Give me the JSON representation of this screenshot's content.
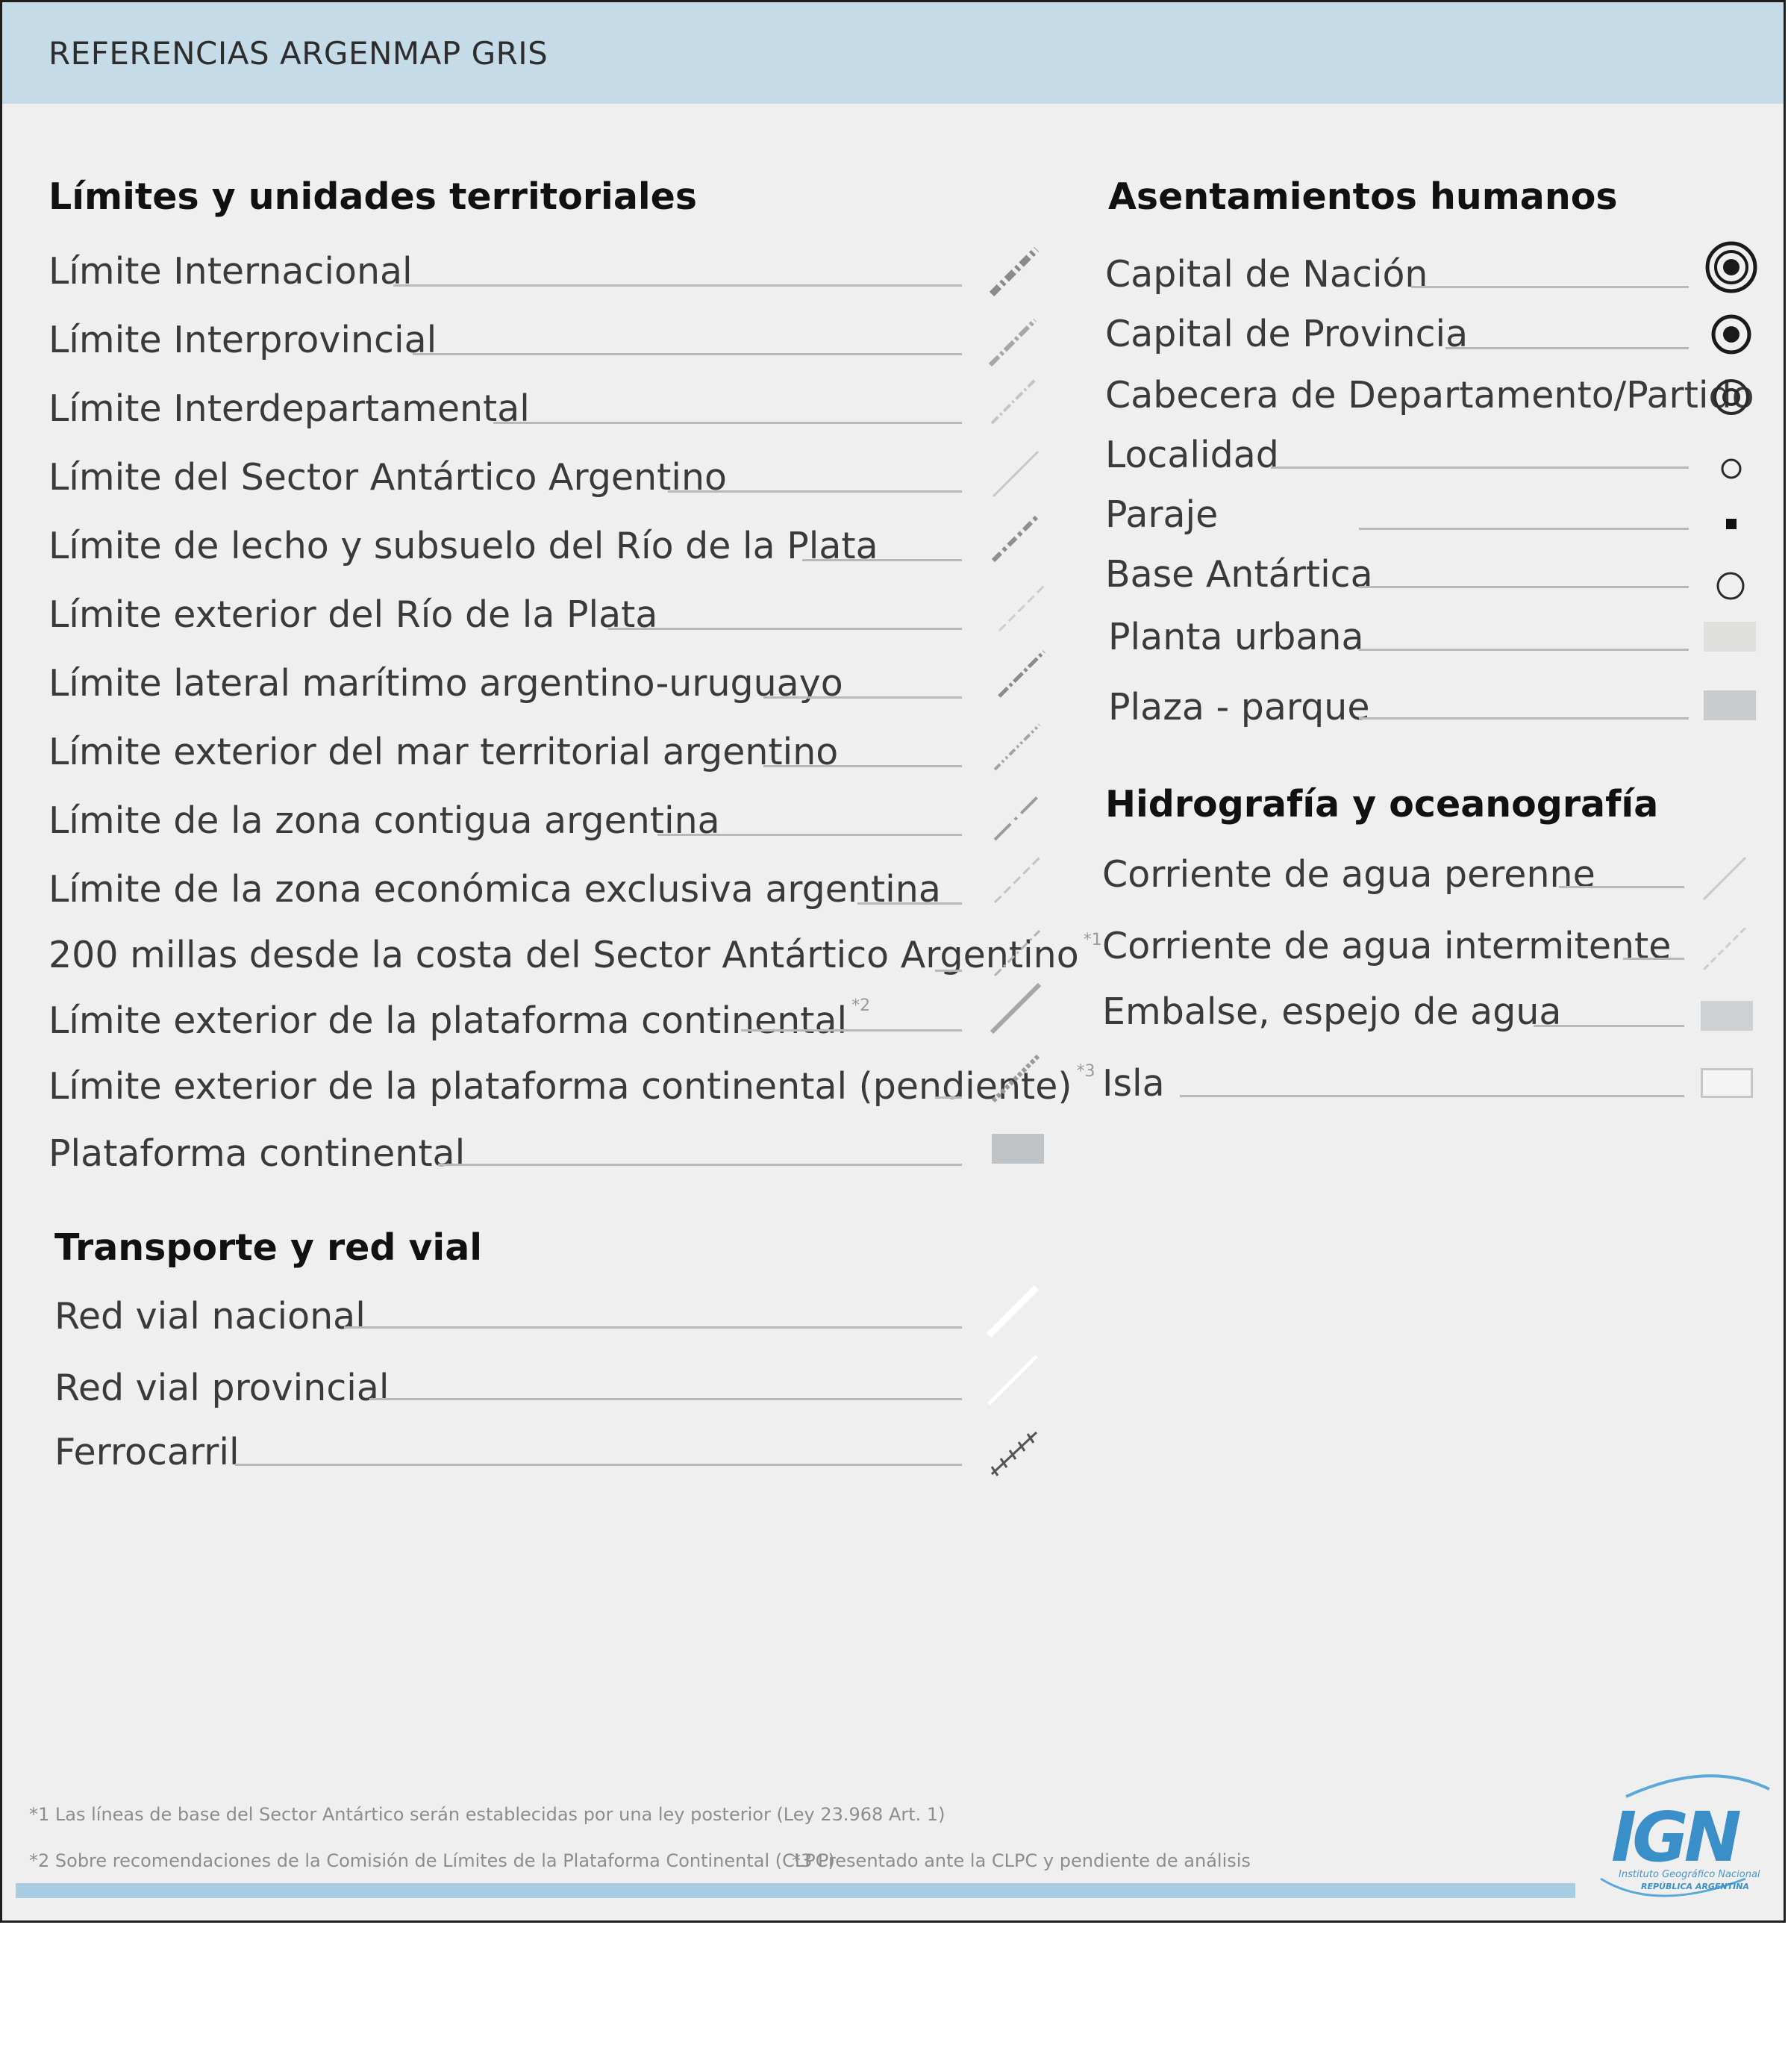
{
  "title": "REFERENCIAS ARGENMAP GRIS",
  "sections": {
    "limites": {
      "title": "Límites y unidades territoriales",
      "items": [
        {
          "label": "Límite Internacional"
        },
        {
          "label": "Límite Interprovincial"
        },
        {
          "label": "Límite Interdepartamental"
        },
        {
          "label": "Límite del Sector Antártico Argentino"
        },
        {
          "label": "Límite de lecho y subsuelo del Río de la Plata"
        },
        {
          "label": "Límite exterior del Río de la Plata"
        },
        {
          "label": "Límite lateral marítimo argentino-uruguayo"
        },
        {
          "label": "Límite exterior del mar territorial argentino"
        },
        {
          "label": "Límite de la zona contigua argentina"
        },
        {
          "label": "Límite de la zona económica exclusiva argentina"
        },
        {
          "label": "200 millas desde la costa del Sector Antártico Argentino",
          "note": "*1"
        },
        {
          "label": "Límite exterior de la plataforma continental",
          "note": "*2"
        },
        {
          "label": "Límite exterior de la plataforma continental (pendiente)",
          "note": "*3"
        },
        {
          "label": "Plataforma continental"
        }
      ]
    },
    "transporte": {
      "title": "Transporte y red vial",
      "items": [
        {
          "label": "Red vial nacional"
        },
        {
          "label": "Red vial provincial"
        },
        {
          "label": "Ferrocarril"
        }
      ]
    },
    "asentamientos": {
      "title": "Asentamientos humanos",
      "items": [
        {
          "label": "Capital de Nación"
        },
        {
          "label": "Capital de Provincia"
        },
        {
          "label": "Cabecera de Departamento/Partido"
        },
        {
          "label": "Localidad"
        },
        {
          "label": "Paraje"
        },
        {
          "label": "Base Antártica"
        },
        {
          "label": "Planta urbana"
        },
        {
          "label": "Plaza - parque"
        }
      ]
    },
    "hidrografia": {
      "title": "Hidrografía y oceanografía",
      "items": [
        {
          "label": "Corriente de agua perenne"
        },
        {
          "label": "Corriente de agua intermitente"
        },
        {
          "label": "Embalse, espejo de agua"
        },
        {
          "label": "Isla"
        }
      ]
    }
  },
  "footnotes": {
    "n1": "*1  Las líneas de base del Sector Antártico serán establecidas por una ley posterior (Ley 23.968 Art. 1)",
    "n2": "*2  Sobre recomendaciones de la Comisión de Límites de la Plataforma Continental (CLPC)",
    "n3": "*3  Presentado ante la CLPC y pendiente de análisis"
  },
  "logo": {
    "text": "IGN",
    "line1": "Instituto Geográfico Nacional",
    "line2": "REPÚBLICA ARGENTINA"
  },
  "colors": {
    "header": "#c5dce8",
    "panel": "#efefef",
    "accent_bar": "#a9cde2",
    "logo_blue": "#3b8fc9"
  }
}
